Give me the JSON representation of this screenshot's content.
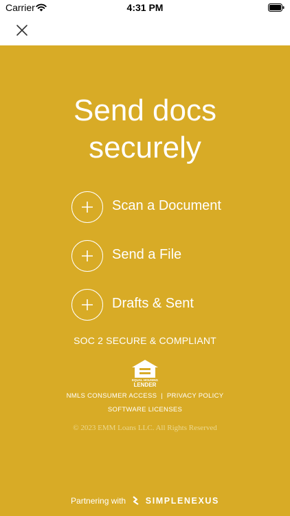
{
  "status_bar": {
    "carrier": "Carrier",
    "time": "4:31 PM"
  },
  "nav": {
    "close_icon": "close-icon"
  },
  "main": {
    "background_color": "#d8ab26",
    "headline_line1": "Send docs",
    "headline_line2": "securely",
    "actions": [
      {
        "label": "Scan a Document",
        "icon": "plus-icon"
      },
      {
        "label": "Send a File",
        "icon": "plus-icon"
      },
      {
        "label": "Drafts & Sent",
        "icon": "plus-icon"
      }
    ],
    "compliance": "SOC 2 SECURE & COMPLIANT",
    "logo_text_line1": "EQUAL HOUSING",
    "logo_text_line2": "LENDER",
    "links": {
      "nmls": "NMLS CONSUMER ACCESS",
      "separator": "|",
      "privacy": "PRIVACY POLICY",
      "licenses": "SOFTWARE LICENSES"
    },
    "copyright": "© 2023 EMM Loans LLC. All Rights Reserved",
    "partner_prefix": "Partnering with",
    "partner_brand": "SIMPLENEXUS"
  }
}
